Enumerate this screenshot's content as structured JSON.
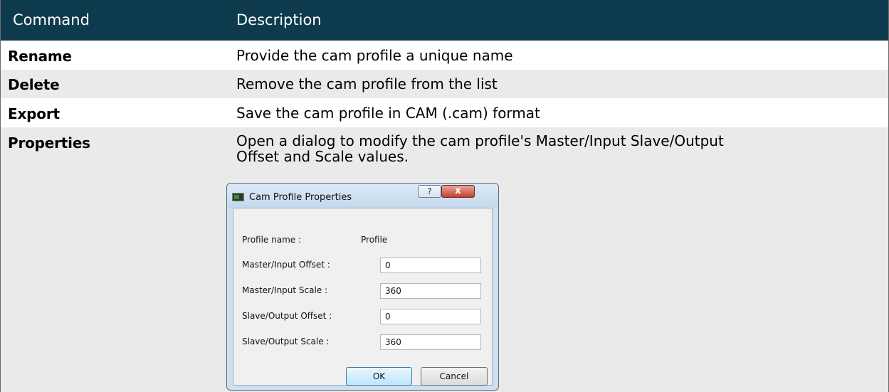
{
  "table": {
    "headers": {
      "command": "Command",
      "description": "Description"
    },
    "rows": [
      {
        "command": "Rename",
        "description": "Provide the cam profile a unique name"
      },
      {
        "command": "Delete",
        "description": "Remove the cam profile from the list"
      },
      {
        "command": "Export",
        "description": "Save the cam profile in CAM (.cam) format"
      },
      {
        "command": "Properties",
        "description": "Open a dialog to modify the cam profile's Master/Input Slave/Output Offset and Scale values."
      }
    ]
  },
  "dialog": {
    "title": "Cam Profile Properties",
    "help_glyph": "?",
    "close_glyph": "x",
    "profile_name_label": "Profile name :",
    "profile_name_value": "Profile",
    "fields": [
      {
        "label": "Master/Input Offset :",
        "value": "0"
      },
      {
        "label": "Master/Input Scale :",
        "value": "360"
      },
      {
        "label": "Slave/Output Offset :",
        "value": "0"
      },
      {
        "label": "Slave/Output Scale :",
        "value": "360"
      }
    ],
    "ok_label": "OK",
    "cancel_label": "Cancel"
  },
  "colors": {
    "header_bg": "#0e3a4e",
    "header_text": "#ffffff",
    "alt_row_bg": "#eaeaea"
  }
}
